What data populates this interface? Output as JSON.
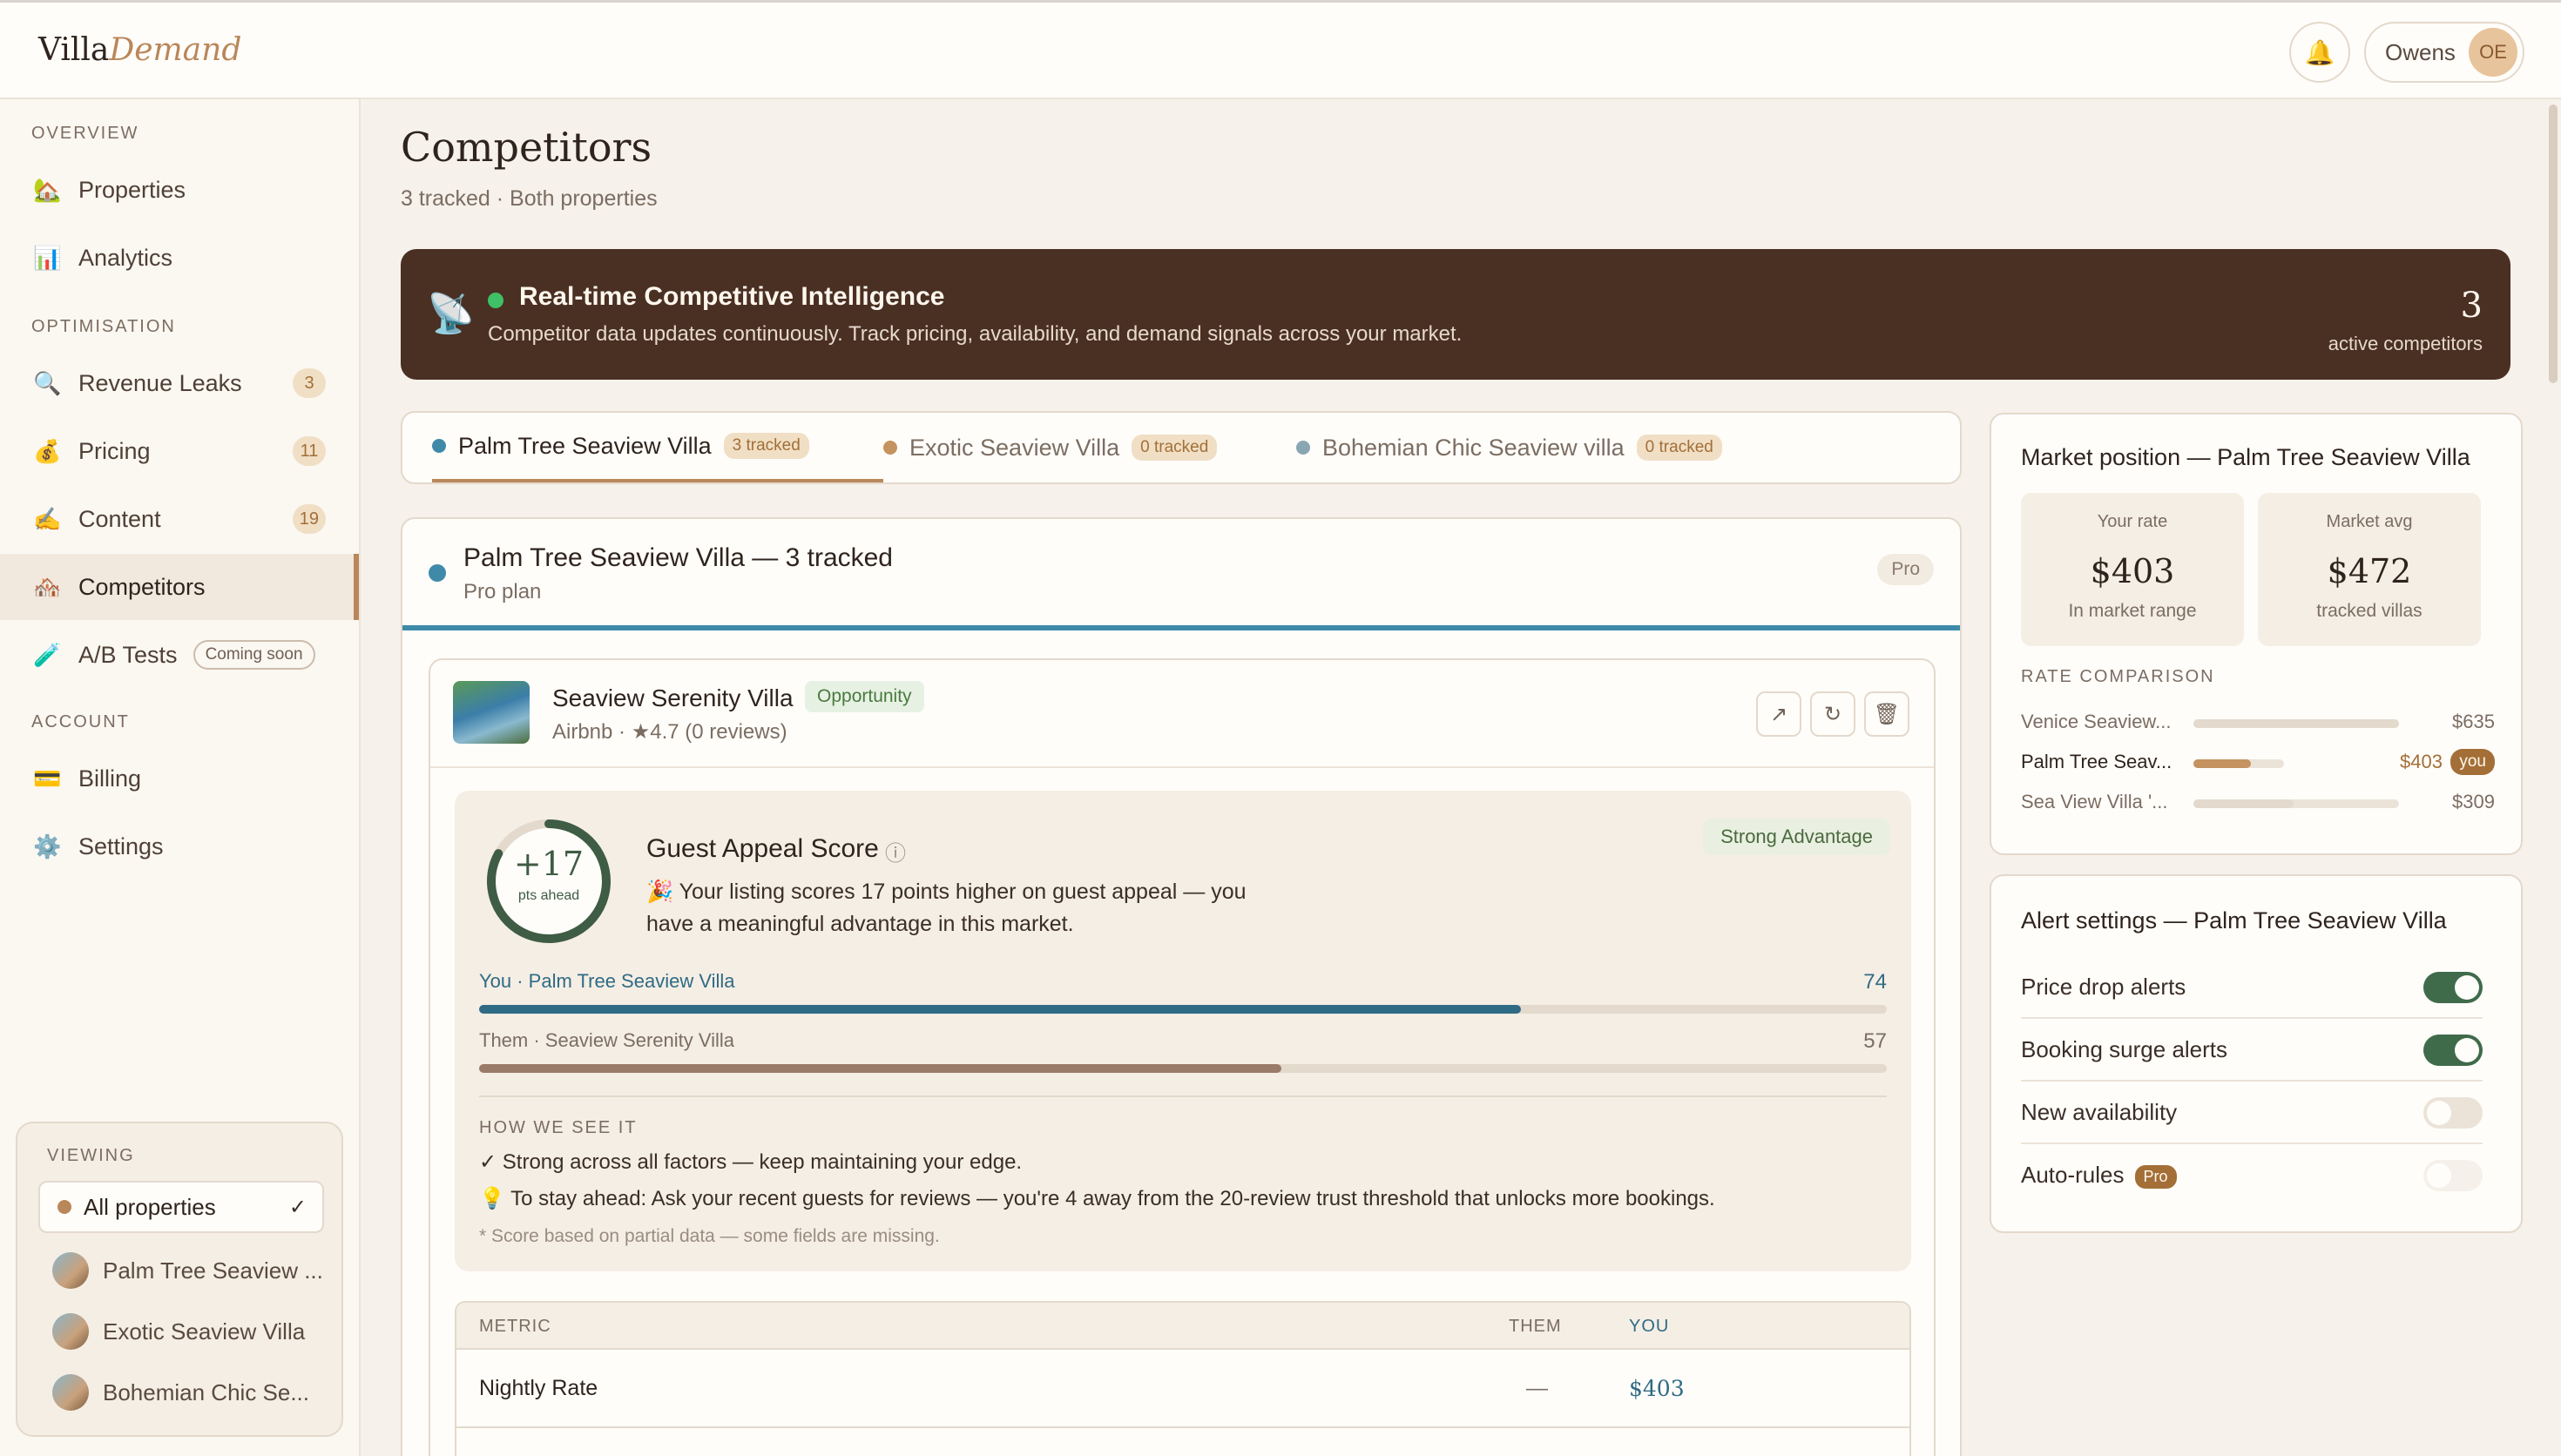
{
  "app": {
    "logo_main": "Villa",
    "logo_accent": "Demand",
    "user_name": "Owens",
    "user_initials": "OE",
    "bell_icon": "bell-icon"
  },
  "sidebar": {
    "sections": {
      "overview": "OVERVIEW",
      "optimisation": "OPTIMISATION",
      "account": "ACCOUNT"
    },
    "items": [
      {
        "label": "Properties",
        "icon": "🏡"
      },
      {
        "label": "Analytics",
        "icon": "📊"
      },
      {
        "label": "Revenue Leaks",
        "icon": "🔍",
        "badge": "3"
      },
      {
        "label": "Pricing",
        "icon": "💰",
        "badge": "11"
      },
      {
        "label": "Content",
        "icon": "✍️",
        "badge": "19"
      },
      {
        "label": "Competitors",
        "icon": "🏘️"
      },
      {
        "label": "A/B Tests",
        "icon": "🧪",
        "tag": "Coming soon"
      },
      {
        "label": "Billing",
        "icon": "💳"
      },
      {
        "label": "Settings",
        "icon": "⚙️"
      }
    ],
    "viewing": {
      "title": "VIEWING",
      "all_label": "All properties",
      "check": "✓",
      "properties": [
        "Palm Tree Seaview ...",
        "Exotic Seaview Villa",
        "Bohemian Chic Se..."
      ]
    }
  },
  "page": {
    "title": "Competitors",
    "subtitle": "3 tracked · Both properties"
  },
  "banner": {
    "icon": "📡",
    "title": "Real-time Competitive Intelligence",
    "text": "Competitor data updates continuously. Track pricing, availability, and demand signals across your market.",
    "count": "3",
    "count_label": "active competitors"
  },
  "tabs": [
    {
      "label": "Palm Tree Seaview Villa",
      "badge": "3 tracked",
      "color": "#3f8aa8"
    },
    {
      "label": "Exotic Seaview Villa",
      "badge": "0 tracked",
      "color": "#c4935f"
    },
    {
      "label": "Bohemian Chic Seaview villa",
      "badge": "0 tracked",
      "color": "#8aa6b3"
    }
  ],
  "property_panel": {
    "title": "Palm Tree Seaview Villa — 3 tracked",
    "subtitle": "Pro plan",
    "plan_pill": "Pro"
  },
  "competitor": {
    "name": "Seaview Serenity Villa",
    "tag": "Opportunity",
    "meta": "Airbnb · ★4.7 (0 reviews)",
    "actions": {
      "open": "↗",
      "refresh": "↻",
      "delete": "🗑"
    },
    "appeal": {
      "score": "+17",
      "score_label": "pts ahead",
      "title": "Guest Appeal Score",
      "info": "ⓘ",
      "verdict": "Strong Advantage",
      "text": "🎉 Your listing scores 17 points higher on guest appeal — you have a meaningful advantage in this market.",
      "you_label": "You · Palm Tree Seaview Villa",
      "you_value": "74",
      "them_label": "Them · Seaview Serenity Villa",
      "them_value": "57",
      "how_title": "HOW WE SEE IT",
      "insight_1": "✓ Strong across all factors — keep maintaining your edge.",
      "insight_2": "💡 To stay ahead: Ask your recent guests for reviews — you're 4 away from the 20-review trust threshold that unlocks more bookings.",
      "footnote": "* Score based on partial data — some fields are missing."
    },
    "metrics": {
      "headers": {
        "metric": "METRIC",
        "them": "THEM",
        "you": "YOU"
      },
      "rows": [
        {
          "metric": "Nightly Rate",
          "them": "—",
          "you": "$403"
        }
      ]
    }
  },
  "market_position": {
    "title": "Market position — Palm Tree Seaview Villa",
    "your_rate_label": "Your rate",
    "your_rate": "$403",
    "your_rate_sub": "In market range",
    "market_avg_label": "Market avg",
    "market_avg": "$472",
    "market_avg_sub": "tracked villas",
    "rate_comparison_title": "RATE COMPARISON",
    "rates": [
      {
        "name": "Venice Seaview...",
        "value": "$635",
        "amount": 635
      },
      {
        "name": "Palm Tree Seav...",
        "value": "$403",
        "amount": 403,
        "you": "you"
      },
      {
        "name": "Sea View Villa '...",
        "value": "$309",
        "amount": 309
      }
    ]
  },
  "alerts": {
    "title": "Alert settings — Palm Tree Seaview Villa",
    "items": [
      {
        "label": "Price drop alerts",
        "on": true
      },
      {
        "label": "Booking surge alerts",
        "on": true
      },
      {
        "label": "New availability",
        "on": false
      },
      {
        "label": "Auto-rules",
        "on": false,
        "tag": "Pro"
      }
    ]
  },
  "colors": {
    "accent": "#b9875a",
    "banner": "#4a2f23",
    "you_bar": "#2f6b84",
    "them_bar": "#9a7a68",
    "toggle_on": "#3f6b4a"
  }
}
